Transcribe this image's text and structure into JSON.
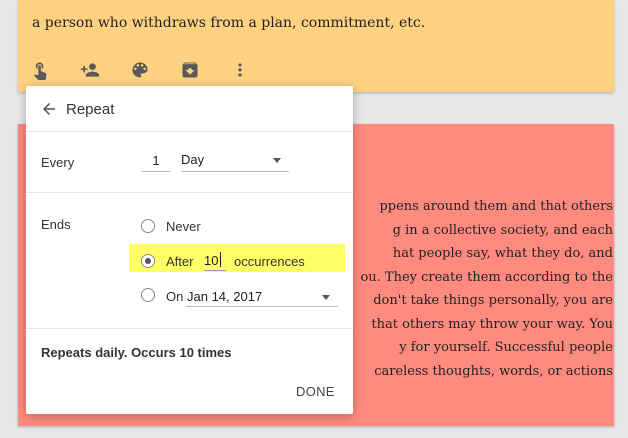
{
  "yellow_note": {
    "text": "a person who withdraws from a plan, commitment, etc.",
    "toolbar_icons": [
      "reminder-icon",
      "collaborator-icon",
      "palette-icon",
      "archive-icon",
      "more-icon"
    ]
  },
  "red_note": {
    "lines": [
      "ppens around them and that others",
      "g in a collective society, and each",
      "hat people say, what they do, and",
      "ou. They create them according to the",
      "don't take things personally, you are",
      "that others may throw your way. You",
      "y for yourself. Successful people",
      "careless thoughts, words, or actions"
    ]
  },
  "dialog": {
    "title": "Repeat",
    "every_label": "Every",
    "every_value": "1",
    "frequency": "Day",
    "ends_label": "Ends",
    "never_label": "Never",
    "after_label": "After",
    "occurrences_value": "10",
    "occurrences_label": "occurrences",
    "on_label": "On",
    "on_date": "Jan 14, 2017",
    "selected_end": "after",
    "summary": "Repeats daily. Occurs 10 times",
    "done_label": "DONE"
  },
  "colors": {
    "yellow_note": "#ffd180",
    "red_note": "#ff8a80",
    "highlight": "#ffff66"
  }
}
